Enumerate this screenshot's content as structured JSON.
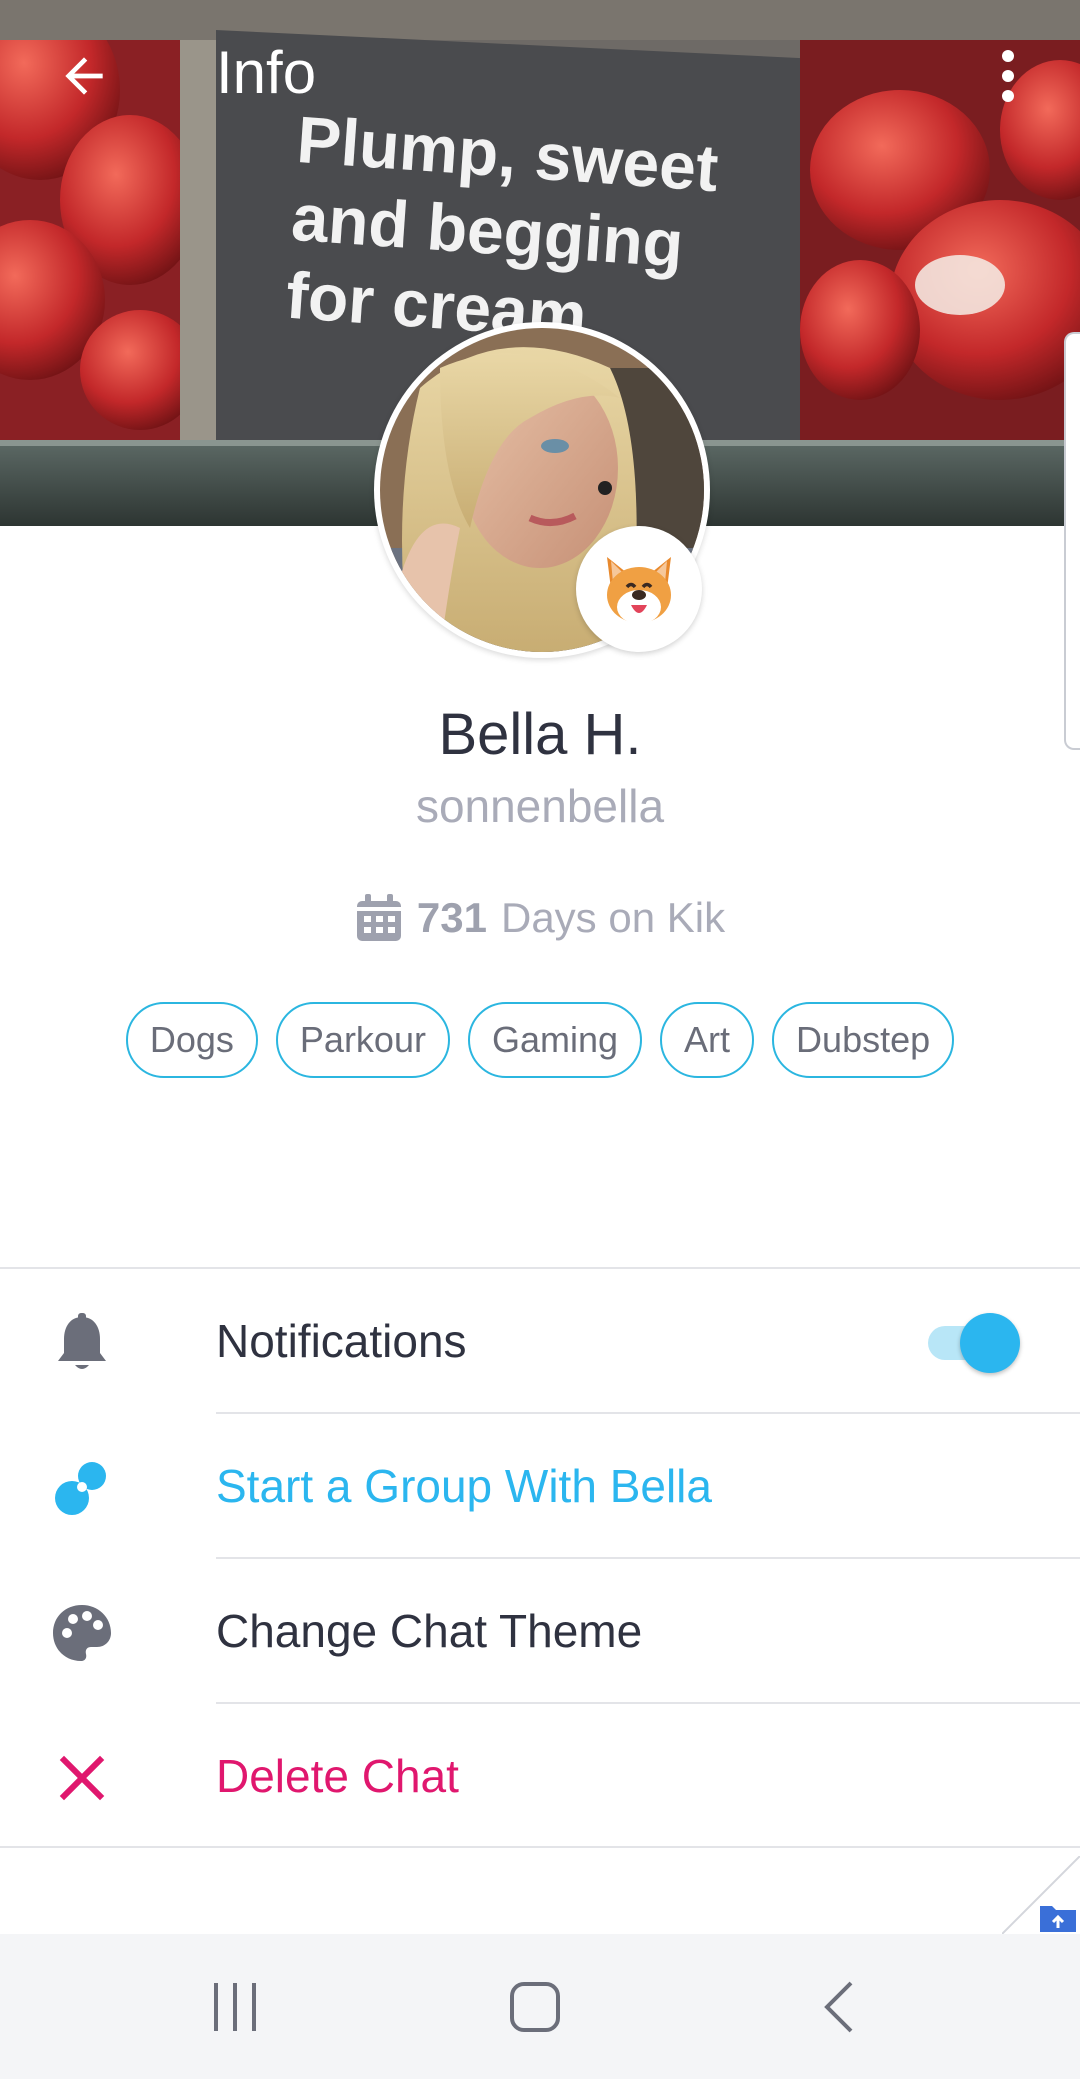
{
  "topbar": {
    "title": "Info"
  },
  "banner": {
    "sign_lines": [
      "Plump, sweet",
      "and begging",
      "for cream"
    ]
  },
  "profile": {
    "name": "Bella H.",
    "username": "sonnenbella",
    "days_count": "731",
    "days_label": "Days on Kik",
    "emoji": "🐶",
    "tags": [
      "Dogs",
      "Parkour",
      "Gaming",
      "Art",
      "Dubstep"
    ]
  },
  "menu": {
    "notifications": "Notifications",
    "notifications_on": true,
    "start_group": "Start a Group With Bella",
    "change_theme": "Change Chat Theme",
    "delete_chat": "Delete Chat"
  },
  "icons": {
    "back": "arrow-left-icon",
    "more": "more-vertical-icon",
    "calendar": "calendar-icon",
    "bell": "bell-icon",
    "group": "group-icon",
    "palette": "palette-icon",
    "close": "close-icon",
    "nav_recents": "recents-icon",
    "nav_home": "home-icon",
    "nav_back": "nav-back-icon"
  },
  "colors": {
    "accent": "#2bb6ef",
    "danger": "#e0176e",
    "text_primary": "#2f3240",
    "text_muted": "#a9abb8"
  }
}
